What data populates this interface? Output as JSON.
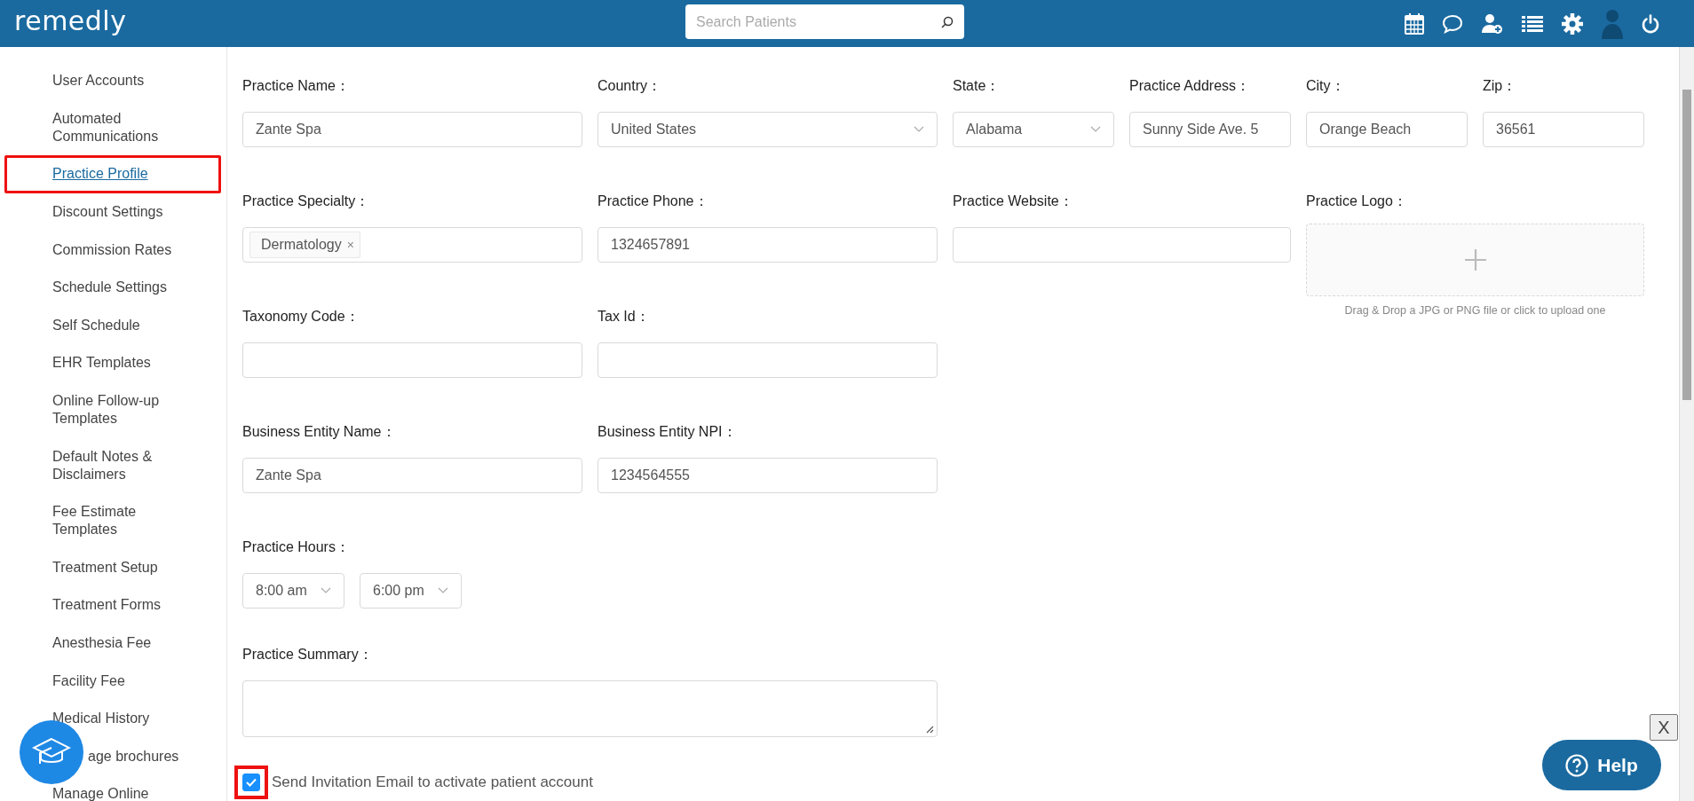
{
  "header": {
    "logo": "remedly",
    "search": {
      "placeholder": "Search Patients"
    }
  },
  "sidebar": {
    "items": [
      {
        "label": "User Accounts",
        "selected": false,
        "highlighted": false
      },
      {
        "label": "Automated Communications",
        "selected": false,
        "highlighted": false
      },
      {
        "label": "Practice Profile",
        "selected": true,
        "highlighted": true
      },
      {
        "label": "Discount Settings",
        "selected": false,
        "highlighted": false
      },
      {
        "label": "Commission Rates",
        "selected": false,
        "highlighted": false
      },
      {
        "label": "Schedule Settings",
        "selected": false,
        "highlighted": false
      },
      {
        "label": "Self Schedule",
        "selected": false,
        "highlighted": false
      },
      {
        "label": "EHR Templates",
        "selected": false,
        "highlighted": false
      },
      {
        "label": "Online Follow-up Templates",
        "selected": false,
        "highlighted": false
      },
      {
        "label": "Default Notes & Disclaimers",
        "selected": false,
        "highlighted": false
      },
      {
        "label": "Fee Estimate Templates",
        "selected": false,
        "highlighted": false
      },
      {
        "label": "Treatment Setup",
        "selected": false,
        "highlighted": false
      },
      {
        "label": "Treatment Forms",
        "selected": false,
        "highlighted": false
      },
      {
        "label": "Anesthesia Fee",
        "selected": false,
        "highlighted": false
      },
      {
        "label": "Facility Fee",
        "selected": false,
        "highlighted": false
      },
      {
        "label": "Medical History",
        "selected": false,
        "highlighted": false
      },
      {
        "label": "age brochures",
        "selected": false,
        "highlighted": false,
        "kind": "covered"
      },
      {
        "label": "Manage Online",
        "selected": false,
        "highlighted": false
      }
    ]
  },
  "form": {
    "fields": [
      {
        "kind": "text",
        "label": "Practice Name：",
        "value": "Zante Spa"
      },
      {
        "kind": "select",
        "label": "Country：",
        "value": "United States"
      },
      {
        "kind": "select",
        "label": "State：",
        "value": "Alabama"
      },
      {
        "kind": "text",
        "label": "Practice Address：",
        "value": "Sunny Side Ave. 5"
      },
      {
        "kind": "text",
        "label": "City：",
        "value": "Orange Beach"
      },
      {
        "kind": "text",
        "label": "Zip：",
        "value": "36561"
      },
      {
        "kind": "tags",
        "label": "Practice Specialty：",
        "tags": [
          "Dermatology"
        ],
        "remove": "×"
      },
      {
        "kind": "text",
        "label": "Practice Phone：",
        "value": "1324657891"
      },
      {
        "kind": "text",
        "label": "Practice Website："
      },
      {
        "kind": "upload",
        "label": "Practice Logo："
      },
      {
        "kind": "text",
        "label": "Taxonomy Code："
      },
      {
        "kind": "text",
        "label": "Tax Id："
      },
      {
        "kind": "text",
        "label": "Business Entity Name：",
        "value": "Zante Spa"
      },
      {
        "kind": "text",
        "label": "Business Entity NPI：",
        "value": "1234564555"
      },
      {
        "kind": "time-range",
        "label": "Practice Hours：",
        "values": [
          "8:00 am",
          "6:00 pm"
        ]
      },
      {
        "kind": "textarea",
        "label": "Practice Summary："
      }
    ],
    "logo_hint": "Drag & Drop a JPG or PNG file or click to upload one",
    "invite": {
      "label": "Send Invitation Email to activate patient account",
      "checked": true,
      "highlighted": true
    }
  },
  "help": {
    "label": "Help",
    "close": "X"
  }
}
